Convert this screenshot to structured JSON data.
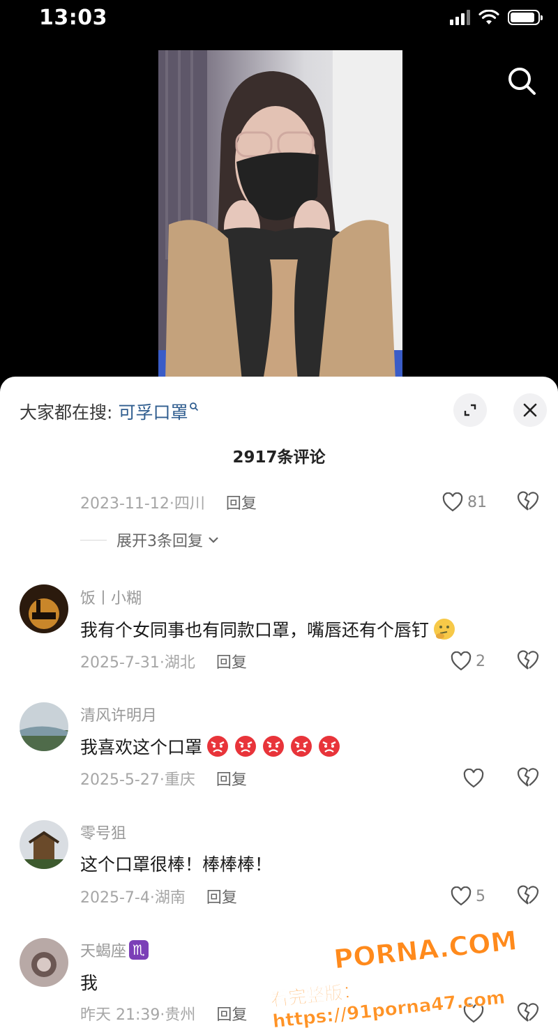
{
  "status_bar": {
    "time": "13:03"
  },
  "sheet": {
    "search_suggest_label": "大家都在搜:",
    "search_suggest_term": "可孚口罩",
    "comment_count_title": "2917条评论"
  },
  "prev_comment": {
    "meta": "2023-11-12·四川",
    "reply_label": "回复",
    "likes": "81",
    "expand_replies": "展开3条回复"
  },
  "comments": [
    {
      "username": "饭丨小糊",
      "text": "我有个女同事也有同款口罩，嘴唇还有个唇钉",
      "emoji": [
        "thinking-face"
      ],
      "meta": "2025-7-31·湖北",
      "reply_label": "回复",
      "likes": "2"
    },
    {
      "username": "清风许明月",
      "text": "我喜欢这个口罩",
      "emoji": [
        "angry-face",
        "angry-face",
        "angry-face",
        "angry-face",
        "angry-face"
      ],
      "meta": "2025-5-27·重庆",
      "reply_label": "回复",
      "likes": ""
    },
    {
      "username": "零号狙",
      "text": "这个口罩很棒！棒棒棒！",
      "emoji": [],
      "meta": "2025-7-4·湖南",
      "reply_label": "回复",
      "likes": "5"
    },
    {
      "username": "天蝎座",
      "badge": "♏",
      "text": "我",
      "emoji": [],
      "meta": "昨天 21:39·贵州",
      "reply_label": "回复",
      "likes": ""
    }
  ],
  "watermark": {
    "line1": "PORNA.COM",
    "line2": "看完整版：https://91porna47.com"
  },
  "colors": {
    "suggest_term": "#2f5d8f",
    "sheet_bg": "#ffffff",
    "meta_gray": "#a6a6a6",
    "watermark": "#ff8a1c"
  }
}
